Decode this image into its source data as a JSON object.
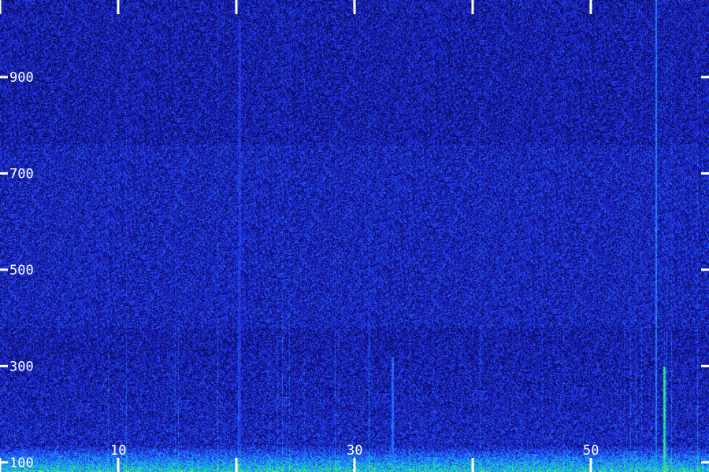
{
  "chart_data": {
    "type": "heatmap",
    "title": "",
    "xlabel": "",
    "ylabel": "",
    "colormap": [
      "#000010",
      "#0a0a5a",
      "#1414b4",
      "#2a46ff",
      "#1e8cff",
      "#12c8e6",
      "#12e678",
      "#aaff3c"
    ],
    "y_ticks": [
      100,
      300,
      500,
      700,
      900
    ],
    "ylim": [
      80,
      1060
    ],
    "x_ticks_top": [
      0,
      1,
      2,
      3,
      4,
      5
    ],
    "x_tick_labels_bottom": [
      {
        "tick": 1,
        "label": "10"
      },
      {
        "tick": 3,
        "label": "30"
      },
      {
        "tick": 5,
        "label": "50"
      }
    ],
    "grid": false,
    "legend": "none",
    "features": [
      {
        "kind": "low-band energy",
        "y_range": [
          80,
          140
        ],
        "level": 0.55
      },
      {
        "kind": "vertical line",
        "x_tick": 5.55,
        "y_range": [
          80,
          1060
        ],
        "level": 0.6
      },
      {
        "kind": "vertical line",
        "x_tick": 5.62,
        "y_range": [
          80,
          300
        ],
        "level": 0.9
      },
      {
        "kind": "vertical line",
        "x_tick": 2.03,
        "y_range": [
          80,
          1020
        ],
        "level": 0.4
      },
      {
        "kind": "vertical line",
        "x_tick": 3.32,
        "y_range": [
          80,
          320
        ],
        "level": 0.55
      }
    ]
  }
}
